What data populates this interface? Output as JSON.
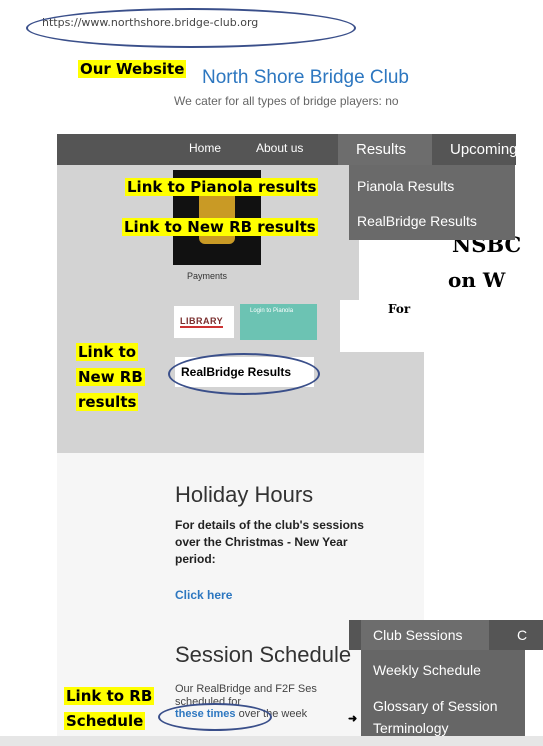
{
  "address_bar": {
    "url": "https://www.northshore.bridge-club.org"
  },
  "annotations": {
    "website": "Our Website",
    "pianola": "Link to Pianola results",
    "new_rb": "Link to New RB results",
    "new_rb_side_1": "Link to",
    "new_rb_side_2": "New RB",
    "new_rb_side_3": "results",
    "schedule_1": "Link to RB",
    "schedule_2": "Schedule"
  },
  "site": {
    "title": "North Shore Bridge Club",
    "tagline": "We cater for all types of bridge players: no"
  },
  "nav": {
    "home": "Home",
    "about": "About us",
    "results": "Results",
    "upcoming": "Upcoming"
  },
  "results_menu": [
    "Pianola Results",
    "RealBridge Results"
  ],
  "sidebar": {
    "payments": "Payments",
    "library": "LIBRARY",
    "pianola_login": "Login to Pianola",
    "rb_button": "RealBridge Results"
  },
  "banner": {
    "line1": "NSBC",
    "line2": "on W",
    "for": "For"
  },
  "holiday": {
    "heading": "Holiday Hours",
    "body": "For details of the club's sessions over the Christmas - New Year period:",
    "link": "Click here"
  },
  "session": {
    "heading": "Session Schedule",
    "text1": "Our RealBridge and F2F Ses",
    "text2": "scheduled for",
    "link": "these times",
    "text3": " over the week"
  },
  "club_menu": {
    "label": "Club Sessions",
    "next": "C",
    "items": [
      "Weekly Schedule",
      "Glossary of Session",
      "Terminology"
    ]
  },
  "colors": {
    "link": "#2d77c0",
    "nav": "#555555",
    "highlight": "#ffff00",
    "oval": "#3a4f8a"
  }
}
